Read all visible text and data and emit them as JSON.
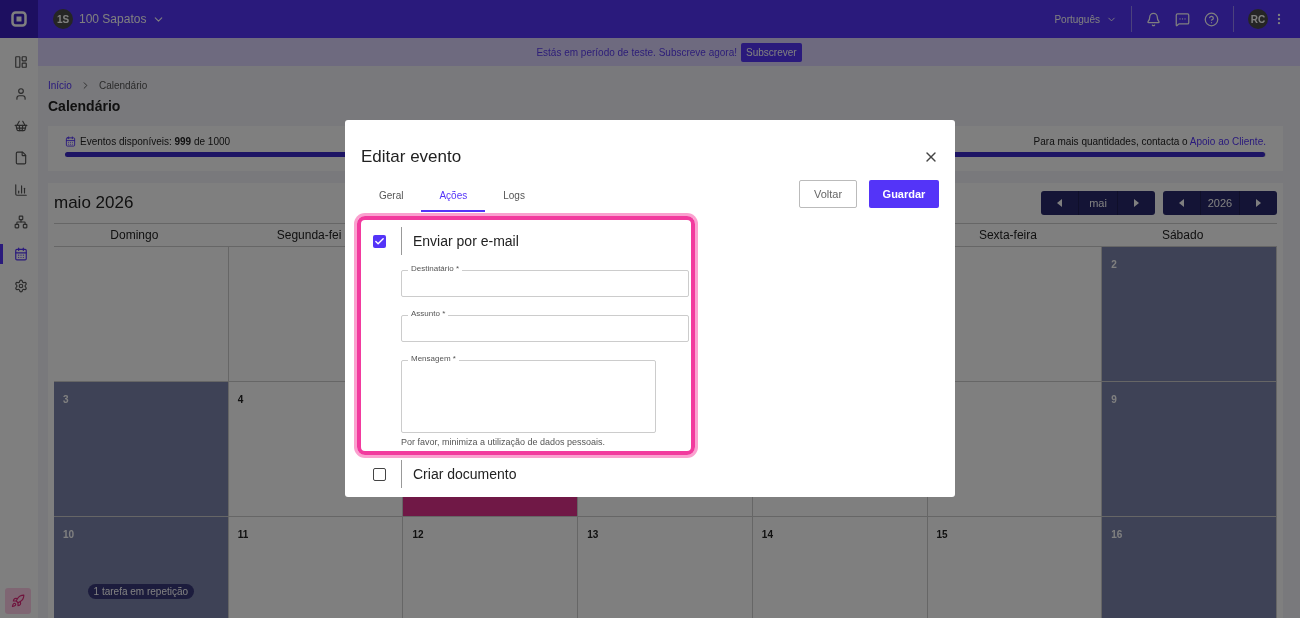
{
  "topbar": {
    "company_initials": "1S",
    "company": "100 Sapatos",
    "language": "Português",
    "user_initials": "RC"
  },
  "sidebar": {
    "items": [
      {
        "kind": "layout",
        "selected": false
      },
      {
        "kind": "user",
        "selected": false
      },
      {
        "kind": "basket",
        "selected": false
      },
      {
        "kind": "file",
        "selected": false
      },
      {
        "kind": "chart",
        "selected": false
      },
      {
        "kind": "network",
        "selected": false
      },
      {
        "kind": "calendar",
        "selected": true
      },
      {
        "kind": "settings",
        "selected": false
      }
    ]
  },
  "banner": {
    "text": "Estás em período de teste. Subscreve agora!",
    "button": "Subscrever"
  },
  "breadcrumb": [
    "Início",
    "Calendário"
  ],
  "page_title": "Calendário",
  "usage": {
    "label": "Eventos disponíveis: **999** de 1000",
    "level": 0.999,
    "note": "Para mais quantidades, contacta o",
    "link": "Apoio ao Cliente."
  },
  "calendar": {
    "title": "maio 2026",
    "month": "mai",
    "year": "2026",
    "weekdays": [
      "Domingo",
      "Segunda-fei",
      "Sexta-feira",
      "Sábado"
    ],
    "weeks": [
      [
        {
          "shaded": false
        },
        {
          "shaded": false
        },
        {
          "shaded": false
        },
        {
          "day": "2",
          "shaded": true
        }
      ],
      [
        {
          "day": "3",
          "shaded": true
        },
        {
          "day": "4",
          "shaded": false
        },
        {
          "shaded": false,
          "event": true
        },
        {
          "shaded": false
        },
        {
          "shaded": false
        },
        {
          "shaded": false
        },
        {
          "day": "9",
          "shaded": true
        }
      ],
      [
        {
          "day": "10",
          "shaded": true,
          "badge": "1 tarefa em repetição"
        },
        {
          "day": "11",
          "shaded": false
        },
        {
          "day": "12",
          "shaded": false
        },
        {
          "day": "13",
          "shaded": false
        },
        {
          "day": "14",
          "shaded": false
        },
        {
          "day": "15",
          "shaded": false
        },
        {
          "day": "16",
          "shaded": true
        }
      ]
    ]
  },
  "modal": {
    "title": "Editar evento",
    "tabs": [
      {
        "label": "Geral",
        "selected": false
      },
      {
        "label": "Ações",
        "selected": true
      },
      {
        "label": "Logs",
        "selected": false
      }
    ],
    "back_button": "Voltar",
    "save_button": "Guardar",
    "actions": [
      {
        "label": "Enviar por e-mail",
        "checked": true,
        "highlighted": true,
        "fields": [
          {
            "kind": "input",
            "label": "Destinatário *"
          },
          {
            "kind": "input",
            "label": "Assunto *"
          },
          {
            "kind": "textarea",
            "label": "Mensagem *"
          }
        ],
        "hint": "Por favor, minimiza a utilização de dados pessoais."
      },
      {
        "label": "Criar documento",
        "checked": false
      }
    ]
  }
}
